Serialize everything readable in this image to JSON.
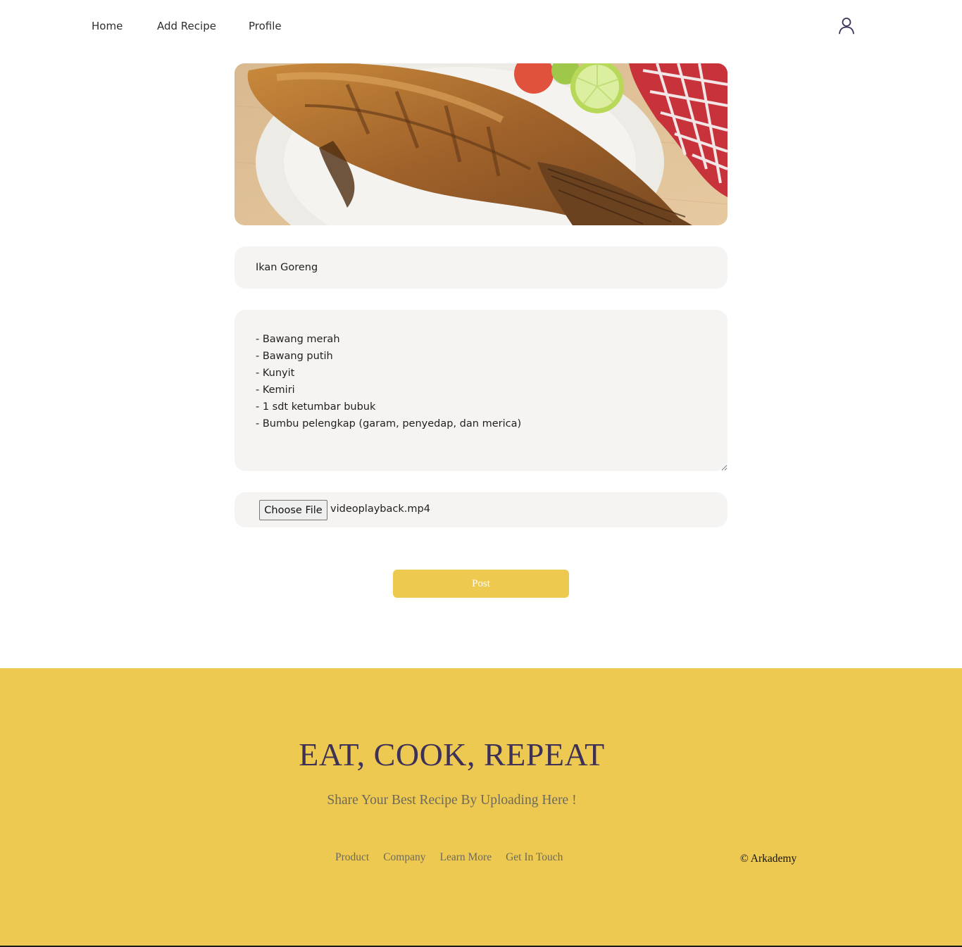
{
  "nav": {
    "home": "Home",
    "add_recipe": "Add Recipe",
    "profile": "Profile",
    "user_icon": "user-icon"
  },
  "hero": {
    "image": "fried-fish-photo"
  },
  "form": {
    "title_value": "Ikan Goreng",
    "ingredients_value": "- Bawang merah\n- Bawang putih\n- Kunyit\n- Kemiri\n- 1 sdt ketumbar bubuk\n- Bumbu pelengkap (garam, penyedap, dan merica)",
    "choose_file_label": "Choose File",
    "file_name": "videoplayback.mp4",
    "post_label": "Post"
  },
  "footer": {
    "headline": "EAT, COOK, REPEAT",
    "subtitle": "Share Your Best Recipe By Uploading Here !",
    "links": [
      "Product",
      "Company",
      "Learn More",
      "Get In Touch"
    ],
    "copyright": "© Arkademy"
  },
  "colors": {
    "accent": "#edc951",
    "headline": "#3d3158",
    "field_bg": "#f5f4f2"
  }
}
